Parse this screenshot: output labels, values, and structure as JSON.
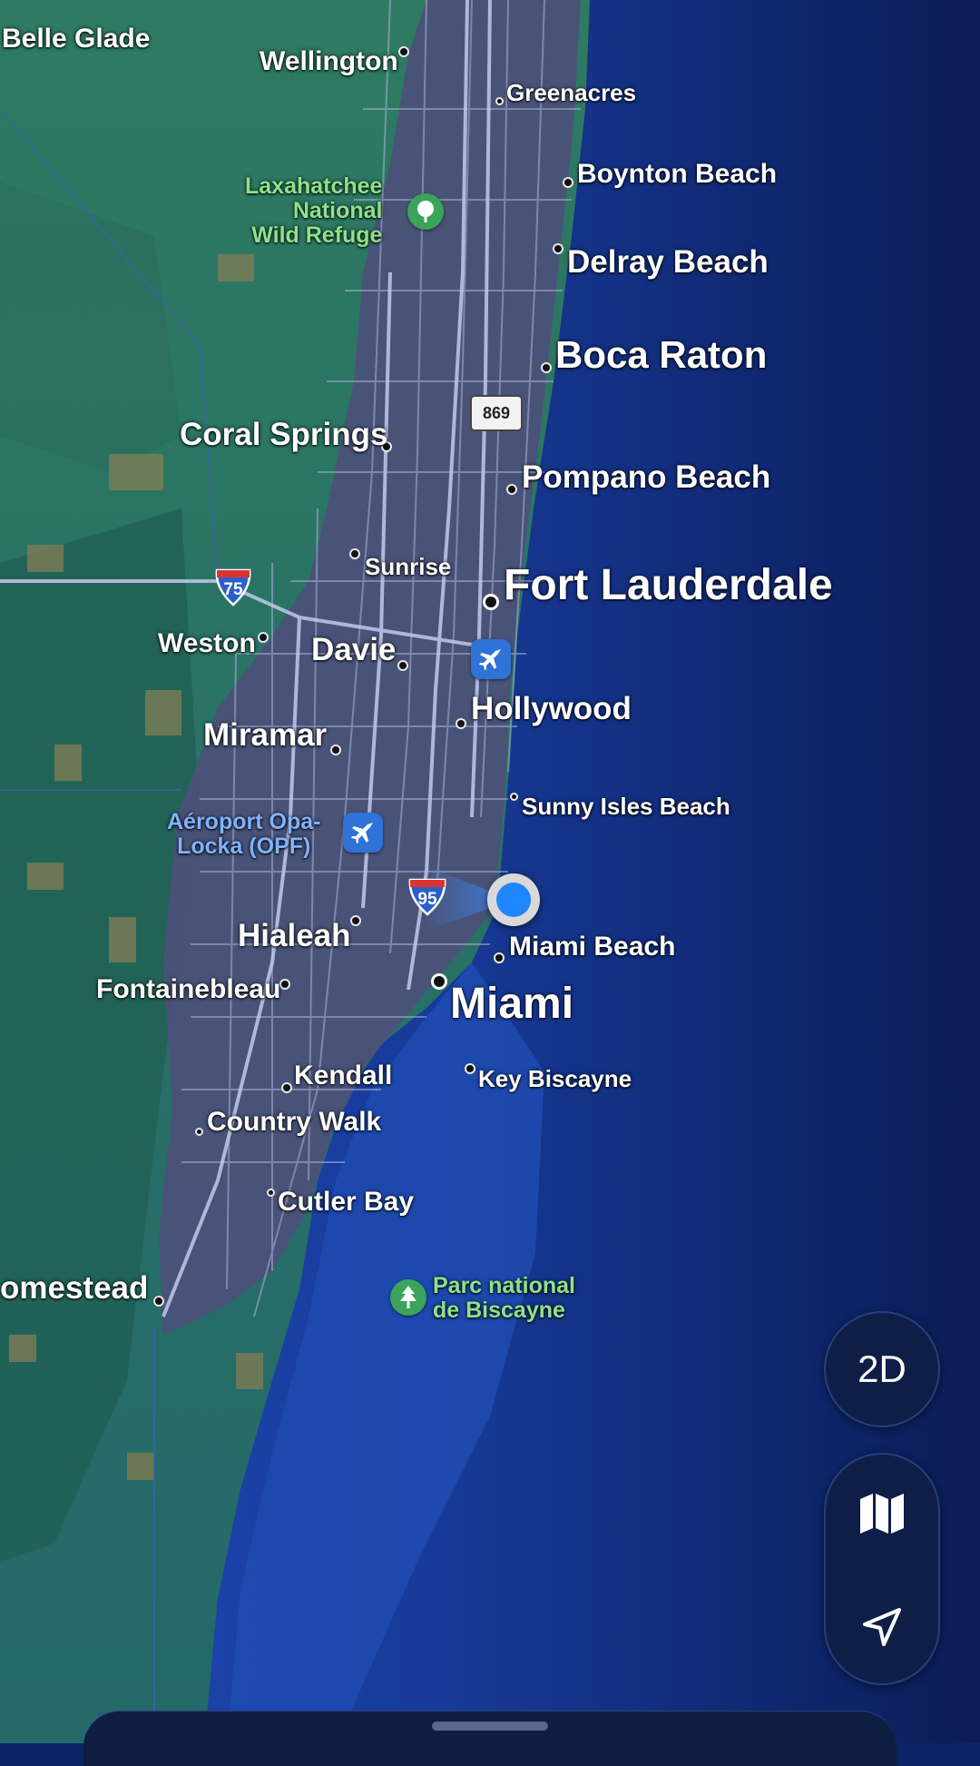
{
  "map": {
    "places": {
      "belle_glade": "Belle Glade",
      "wellington": "Wellington",
      "greenacres": "Greenacres",
      "laxahatchee": "Laxahatchee\nNational\nWild Refuge",
      "boynton_beach": "Boynton Beach",
      "delray_beach": "Delray Beach",
      "boca_raton": "Boca Raton",
      "coral_springs": "Coral Springs",
      "pompano_beach": "Pompano Beach",
      "sunrise": "Sunrise",
      "fort_lauderdale": "Fort Lauderdale",
      "weston": "Weston",
      "davie": "Davie",
      "hollywood": "Hollywood",
      "miramar": "Miramar",
      "sunny_isles_beach": "Sunny Isles Beach",
      "opa_locka_airport": "Aéroport Opa-\nLocka (OPF)",
      "hialeah": "Hialeah",
      "miami_beach": "Miami Beach",
      "fontainebleau": "Fontainebleau",
      "miami": "Miami",
      "kendall": "Kendall",
      "key_biscayne": "Key Biscayne",
      "country_walk": "Country Walk",
      "cutler_bay": "Cutler Bay",
      "homestead": "omestead",
      "biscayne_park": "Parc national\nde Biscayne"
    },
    "shields": {
      "i75": "75",
      "i95": "95",
      "sr869": "869"
    },
    "colors": {
      "ocean": "#13307f",
      "ocean_deep": "#0b1c57",
      "land_green": "#2f7a66",
      "urban": "#4a5177",
      "roads": "#aab2d6",
      "park_text": "#8fe28a",
      "user_location": "#1f86ff"
    }
  },
  "controls": {
    "view_mode_label": "2D",
    "map_mode_icon": "map-icon",
    "locate_icon": "location-arrow-icon"
  }
}
